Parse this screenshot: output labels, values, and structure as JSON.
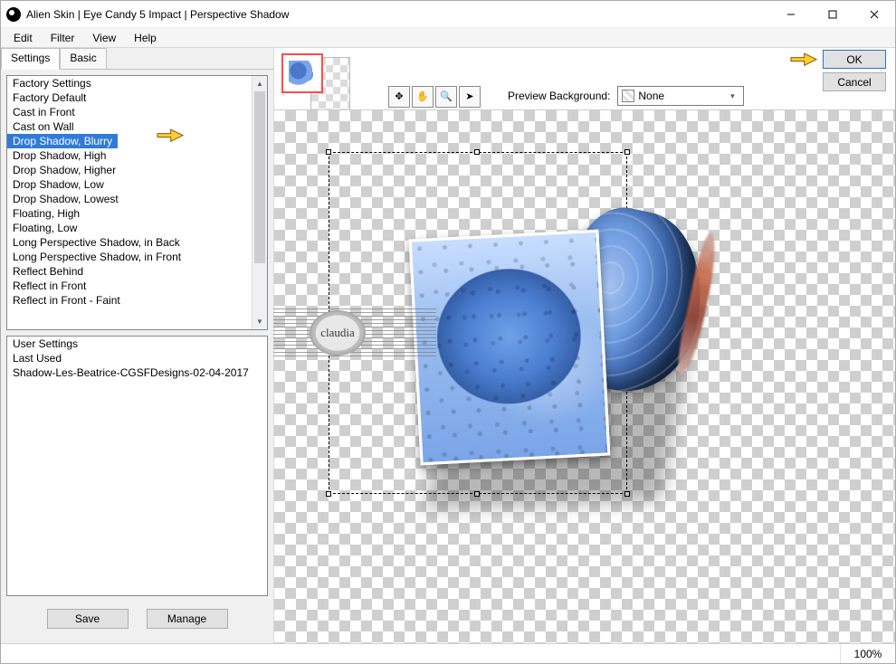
{
  "window": {
    "title": "Alien Skin | Eye Candy 5 Impact | Perspective Shadow"
  },
  "menu": {
    "edit": "Edit",
    "filter": "Filter",
    "view": "View",
    "help": "Help"
  },
  "tabs": {
    "settings": "Settings",
    "basic": "Basic"
  },
  "factory": {
    "header": "Factory Settings",
    "items": [
      "Factory Default",
      "Cast in Front",
      "Cast on Wall",
      "Drop Shadow, Blurry",
      "Drop Shadow, High",
      "Drop Shadow, Higher",
      "Drop Shadow, Low",
      "Drop Shadow, Lowest",
      "Floating, High",
      "Floating, Low",
      "Long Perspective Shadow, in Back",
      "Long Perspective Shadow, in Front",
      "Reflect Behind",
      "Reflect in Front",
      "Reflect in Front - Faint"
    ],
    "selected_index": 3
  },
  "user": {
    "header": "User Settings",
    "items": [
      "Last Used",
      "Shadow-Les-Beatrice-CGSFDesigns-02-04-2017"
    ]
  },
  "buttons": {
    "save": "Save",
    "manage": "Manage",
    "ok": "OK",
    "cancel": "Cancel"
  },
  "preview": {
    "bg_label": "Preview Background:",
    "bg_value": "None"
  },
  "status": {
    "zoom": "100%"
  },
  "watermark": {
    "name": "claudia"
  }
}
